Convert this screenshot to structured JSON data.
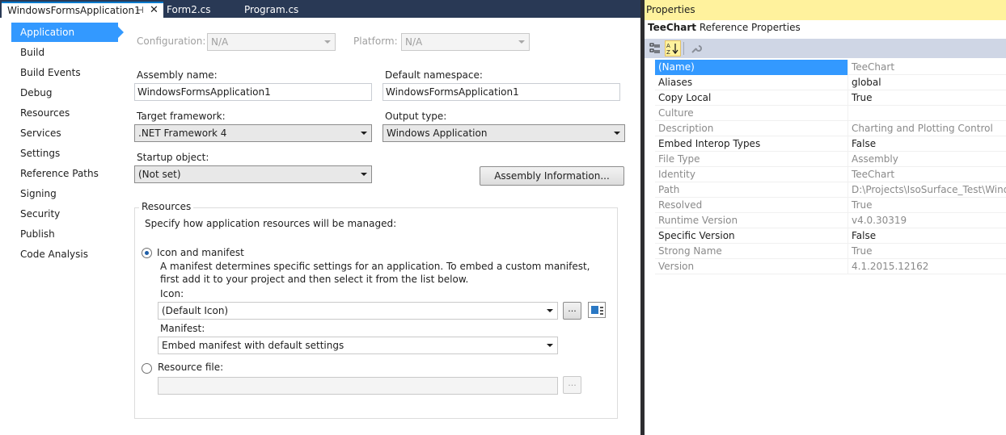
{
  "tabs": [
    {
      "label": "WindowsFormsApplication1",
      "active": true
    },
    {
      "label": "Form2.cs",
      "active": false
    },
    {
      "label": "Program.cs",
      "active": false
    }
  ],
  "tab_icons": {
    "pin": "⊣",
    "close": "✕"
  },
  "nav": [
    "Application",
    "Build",
    "Build Events",
    "Debug",
    "Resources",
    "Services",
    "Settings",
    "Reference Paths",
    "Signing",
    "Security",
    "Publish",
    "Code Analysis"
  ],
  "app": {
    "configuration_label": "Configuration:",
    "configuration_value": "N/A",
    "platform_label": "Platform:",
    "platform_value": "N/A",
    "assembly_name_label": "Assembly name:",
    "assembly_name_value": "WindowsFormsApplication1",
    "default_namespace_label": "Default namespace:",
    "default_namespace_value": "WindowsFormsApplication1",
    "target_framework_label": "Target framework:",
    "target_framework_value": ".NET Framework 4",
    "output_type_label": "Output type:",
    "output_type_value": "Windows Application",
    "startup_object_label": "Startup object:",
    "startup_object_value": "(Not set)",
    "assembly_info_button": "Assembly Information..."
  },
  "resources": {
    "group_title": "Resources",
    "description": "Specify how application resources will be managed:",
    "icon_manifest_label": "Icon and manifest",
    "icon_manifest_description": "A manifest determines specific settings for an application. To embed a custom manifest, first add it to your project and then select it from the list below.",
    "icon_label": "Icon:",
    "icon_value": "(Default Icon)",
    "browse_button": "...",
    "manifest_label": "Manifest:",
    "manifest_value": "Embed manifest with default settings",
    "resource_file_label": "Resource file:",
    "resource_file_value": "",
    "resource_browse_button": "..."
  },
  "properties": {
    "window_title": "Properties",
    "object_name": "TeeChart",
    "object_type": "Reference Properties",
    "rows": [
      {
        "name": "(Name)",
        "value": "TeeChart",
        "readonly": true,
        "selected": true
      },
      {
        "name": "Aliases",
        "value": "global",
        "readonly": false
      },
      {
        "name": "Copy Local",
        "value": "True",
        "readonly": false
      },
      {
        "name": "Culture",
        "value": "",
        "readonly": true
      },
      {
        "name": "Description",
        "value": "Charting and Plotting Control",
        "readonly": true
      },
      {
        "name": "Embed Interop Types",
        "value": "False",
        "readonly": false
      },
      {
        "name": "File Type",
        "value": "Assembly",
        "readonly": true
      },
      {
        "name": "Identity",
        "value": "TeeChart",
        "readonly": true
      },
      {
        "name": "Path",
        "value": "D:\\Projects\\IsoSurface_Test\\Windo",
        "readonly": true
      },
      {
        "name": "Resolved",
        "value": "True",
        "readonly": true
      },
      {
        "name": "Runtime Version",
        "value": "v4.0.30319",
        "readonly": true
      },
      {
        "name": "Specific Version",
        "value": "False",
        "readonly": false
      },
      {
        "name": "Strong Name",
        "value": "True",
        "readonly": true
      },
      {
        "name": "Version",
        "value": "4.1.2015.12162",
        "readonly": true
      }
    ]
  },
  "colors": {
    "tab_bar": "#293955",
    "active_accent": "#007acc",
    "nav_selected": "#3399ff",
    "properties_title": "#fff29d",
    "properties_toolbar": "#cfd6e5"
  },
  "icons": {
    "categorized": "categorized-icon",
    "alphabetical": "alphabetical-sort-icon",
    "property_pages": "wrench-icon"
  }
}
